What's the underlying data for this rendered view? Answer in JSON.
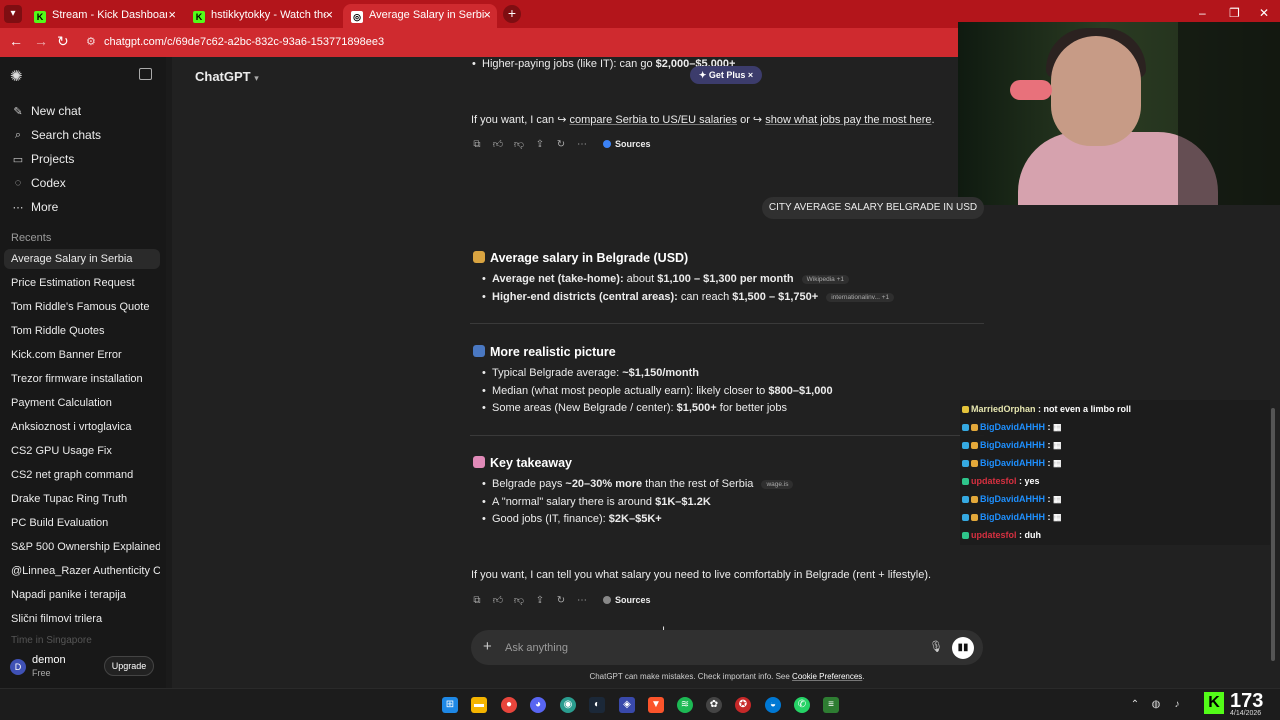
{
  "browser": {
    "tabs": [
      {
        "title": "Stream - Kick Dashboard",
        "favicon": "kick-icon"
      },
      {
        "title": "hstikkytokky - Watch the VOD &",
        "favicon": "kick-icon"
      },
      {
        "title": "Average Salary in Serbia",
        "favicon": "chatgpt-icon"
      }
    ],
    "url": "chatgpt.com/c/69de7c62-a2bc-832c-93a6-153771898ee3"
  },
  "sidebar": {
    "nav": [
      {
        "label": "New chat",
        "icon": "compose-icon"
      },
      {
        "label": "Search chats",
        "icon": "search-icon"
      },
      {
        "label": "Projects",
        "icon": "folder-icon"
      },
      {
        "label": "Codex",
        "icon": "codex-icon"
      },
      {
        "label": "More",
        "icon": "dots-icon"
      }
    ],
    "recents_label": "Recents",
    "chats": [
      "Average Salary in Serbia",
      "Price Estimation Request",
      "Tom Riddle's Famous Quote",
      "Tom Riddle Quotes",
      "Kick.com Banner Error",
      "Trezor firmware installation",
      "Payment Calculation",
      "Anksioznost i vrtoglavica",
      "CS2 GPU Usage Fix",
      "CS2 net graph command",
      "Drake Tupac Ring Truth",
      "PC Build Evaluation",
      "S&P 500 Ownership Explained",
      "@Linnea_Razer Authenticity Check",
      "Napadi panike i terapija",
      "Slični filmovi trilera",
      "Time in Singapore"
    ],
    "user": {
      "initial": "D",
      "name": "demon",
      "plan": "Free",
      "upgrade": "Upgrade"
    }
  },
  "main": {
    "model": "ChatGPT",
    "get_plus": "Get Plus",
    "top_bullet_pre": "Higher-paying jobs (like IT): can go ",
    "top_bullet_bold": "$2,000–$5,000+",
    "prev_followup": {
      "pre": "If you want, I can ",
      "link1": "compare Serbia to US/EU salaries",
      "mid": " or ",
      "link2": "show what jobs pay the most here",
      "post": "."
    },
    "sources_label": "Sources",
    "user_message": "CITY AVERAGE SALARY BELGRADE IN USD",
    "section1": {
      "title": "Average salary in Belgrade (USD)",
      "b1_bold": "Average net (take-home):",
      "b1_rest": " about ",
      "b1_value": "$1,100 – $1,300 per month",
      "b1_chip": "Wikipedia +1",
      "b2_bold": "Higher-end districts (central areas):",
      "b2_rest": " can reach ",
      "b2_value": "$1,500 – $1,750+",
      "b2_chip": "internationalinv... +1"
    },
    "section2": {
      "title": "More realistic picture",
      "b1_pre": "Typical Belgrade average: ",
      "b1_bold": "~$1,150/month",
      "b2_pre": "Median (what most people actually earn): likely closer to ",
      "b2_bold": "$800–$1,000",
      "b3_pre": "Some areas (New Belgrade / center): ",
      "b3_bold": "$1,500+",
      "b3_post": " for better jobs"
    },
    "section3": {
      "title": "Key takeaway",
      "b1_pre": "Belgrade pays ",
      "b1_bold": "~20–30% more",
      "b1_post": " than the rest of Serbia",
      "b1_chip": "wage.is",
      "b2_pre": "A \"normal\" salary there is around ",
      "b2_bold": "$1K–$1.2K",
      "b3_pre": "Good jobs (IT, finance): ",
      "b3_bold": "$2K–$5K+"
    },
    "followup": "If you want, I can tell you what salary you need to live comfortably in Belgrade (rent + lifestyle).",
    "input_placeholder": "Ask anything",
    "disclaimer_pre": "ChatGPT can make mistakes. Check important info. See ",
    "disclaimer_link": "Cookie Preferences",
    "disclaimer_post": "."
  },
  "stream_chat": [
    {
      "user": "MarriedOrphan",
      "msg": "not even a limbo roll",
      "color": "#e6e6b0"
    },
    {
      "user": "BigDavidAHHH",
      "msg": "",
      "color": "#1e90ff"
    },
    {
      "user": "BigDavidAHHH",
      "msg": "",
      "color": "#1e90ff"
    },
    {
      "user": "BigDavidAHHH",
      "msg": "",
      "color": "#1e90ff"
    },
    {
      "user": "updatesfol",
      "msg": "yes",
      "color": "#d63040"
    },
    {
      "user": "BigDavidAHHH",
      "msg": "",
      "color": "#1e90ff"
    },
    {
      "user": "BigDavidAHHH",
      "msg": "",
      "color": "#1e90ff"
    },
    {
      "user": "updatesfol",
      "msg": "duh",
      "color": "#d63040"
    }
  ],
  "viewer_count": "173",
  "clock_date": "4/14/2026"
}
